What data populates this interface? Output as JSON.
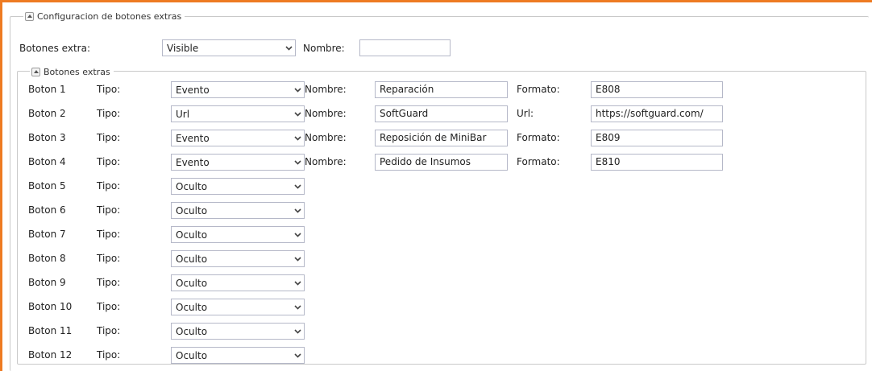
{
  "outer_section": {
    "title": "Configuracion de botones extras",
    "visibility_label": "Botones extra:",
    "visibility_value": "Visible",
    "name_label": "Nombre:",
    "name_value": ""
  },
  "inner_section": {
    "title": "Botones extras"
  },
  "buttons": [
    {
      "label": "Boton 1",
      "tipo_label": "Tipo:",
      "tipo": "Evento",
      "nombre_label": "Nombre:",
      "nombre": "Reparación",
      "extra_label": "Formato:",
      "extra": "E808"
    },
    {
      "label": "Boton 2",
      "tipo_label": "Tipo:",
      "tipo": "Url",
      "nombre_label": "Nombre:",
      "nombre": "SoftGuard",
      "extra_label": "Url:",
      "extra": "https://softguard.com/"
    },
    {
      "label": "Boton 3",
      "tipo_label": "Tipo:",
      "tipo": "Evento",
      "nombre_label": "Nombre:",
      "nombre": "Reposición de MiniBar",
      "extra_label": "Formato:",
      "extra": "E809"
    },
    {
      "label": "Boton 4",
      "tipo_label": "Tipo:",
      "tipo": "Evento",
      "nombre_label": "Nombre:",
      "nombre": "Pedido de Insumos",
      "extra_label": "Formato:",
      "extra": "E810"
    },
    {
      "label": "Boton 5",
      "tipo_label": "Tipo:",
      "tipo": "Oculto"
    },
    {
      "label": "Boton 6",
      "tipo_label": "Tipo:",
      "tipo": "Oculto"
    },
    {
      "label": "Boton 7",
      "tipo_label": "Tipo:",
      "tipo": "Oculto"
    },
    {
      "label": "Boton 8",
      "tipo_label": "Tipo:",
      "tipo": "Oculto"
    },
    {
      "label": "Boton 9",
      "tipo_label": "Tipo:",
      "tipo": "Oculto"
    },
    {
      "label": "Boton 10",
      "tipo_label": "Tipo:",
      "tipo": "Oculto"
    },
    {
      "label": "Boton 11",
      "tipo_label": "Tipo:",
      "tipo": "Oculto"
    },
    {
      "label": "Boton 12",
      "tipo_label": "Tipo:",
      "tipo": "Oculto"
    }
  ],
  "colors": {
    "accent_border": "#ee7b22",
    "field_border": "#b5b8c8",
    "fieldset_border": "#c9c9c9"
  },
  "icons": {
    "collapse": "chevron-up-icon",
    "dropdown": "chevron-down-icon"
  }
}
